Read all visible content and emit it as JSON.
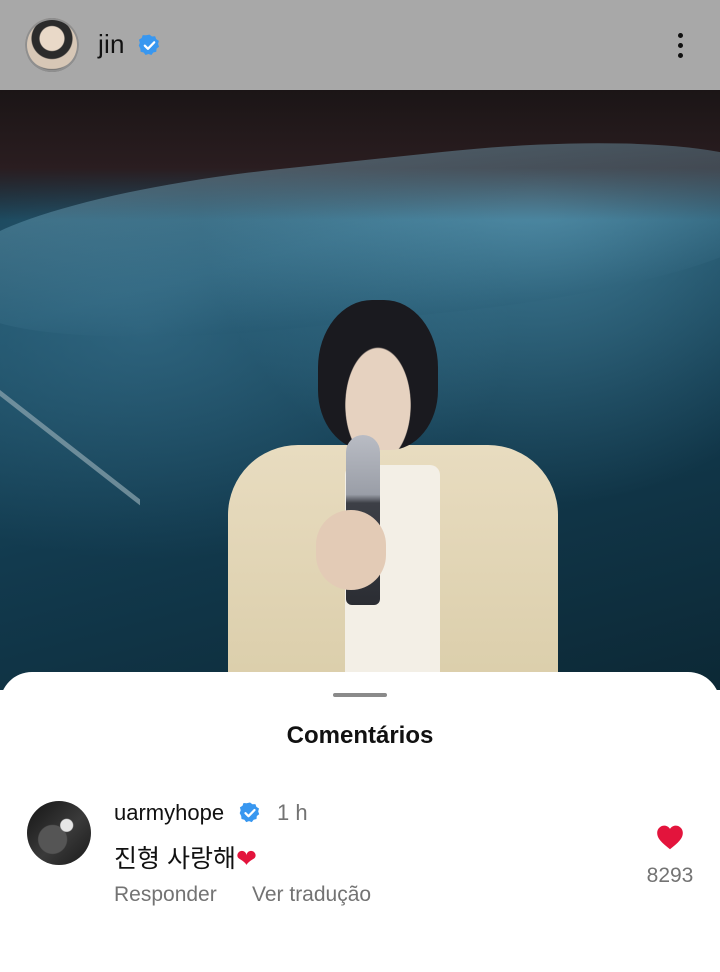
{
  "header": {
    "username": "jin",
    "verified_color": "#3897f0"
  },
  "post": {
    "image_icon": "photo-icon"
  },
  "comments_sheet": {
    "title": "Comentários",
    "comments": [
      {
        "username": "uarmyhope",
        "time": "1 h",
        "text": "진형 사랑해",
        "heart_emoji": "❤",
        "reply_label": "Responder",
        "translate_label": "Ver tradução",
        "like_count": "8293",
        "like_color": "#e3143c"
      }
    ]
  }
}
